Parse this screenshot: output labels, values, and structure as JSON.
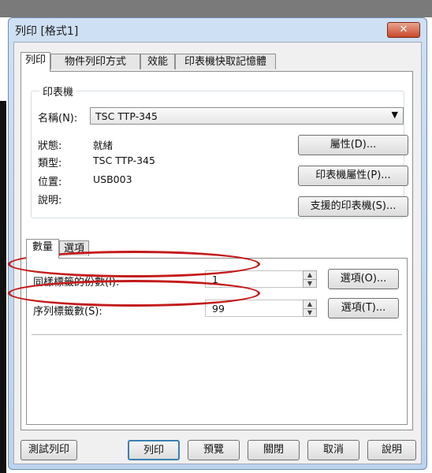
{
  "window": {
    "title": "列印 [格式1]",
    "close_symbol": "✕"
  },
  "tabs": [
    "列印",
    "物件列印方式",
    "效能",
    "印表機快取記憶體"
  ],
  "printer": {
    "legend": "印表機",
    "name_label": "名稱(N):",
    "name_value": "TSC TTP-345",
    "status_label": "狀態:",
    "status_value": "就緒",
    "type_label": "類型:",
    "type_value": "TSC TTP-345",
    "location_label": "位置:",
    "location_value": "USB003",
    "comment_label": "說明:",
    "properties_button": "屬性(D)...",
    "printer_properties_button": "印表機屬性(P)...",
    "supported_printers_button": "支援的印表機(S)..."
  },
  "inner_tabs": [
    "數量",
    "選項"
  ],
  "quantity": {
    "copies_label": "同樣標籤的份數(I):",
    "copies_value": "1",
    "copies_options_button": "選項(O)...",
    "serial_label": "序列標籤數(S):",
    "serial_value": "99",
    "serial_options_button": "選項(T)..."
  },
  "buttons": {
    "test_print": "測試列印",
    "print": "列印",
    "preview": "預覽",
    "close": "關閉",
    "cancel": "取消",
    "help": "說明"
  },
  "colors": {
    "annotation": "#c41a1a"
  }
}
